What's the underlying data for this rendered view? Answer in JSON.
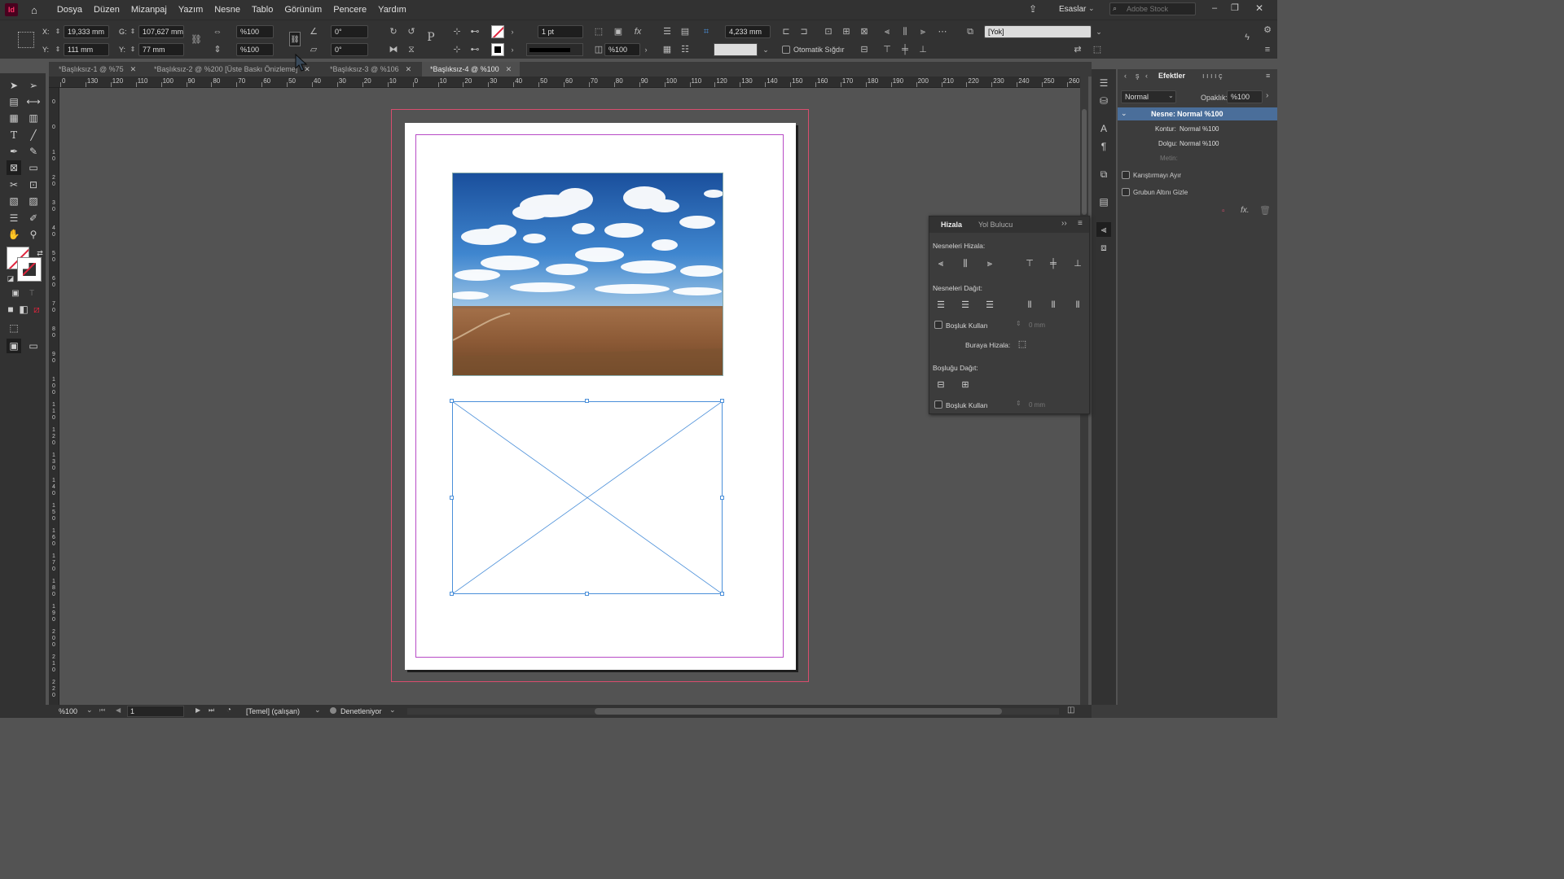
{
  "menubar": {
    "app_icon": "Id",
    "items": [
      "Dosya",
      "Düzen",
      "Mizanpaj",
      "Yazım",
      "Nesne",
      "Tablo",
      "Görünüm",
      "Pencere",
      "Yardım"
    ],
    "workspace": "Esaslar",
    "search_placeholder": "Adobe Stock"
  },
  "control": {
    "x_label": "X:",
    "x_value": "19,333 mm",
    "y_label": "Y:",
    "y_value": "111 mm",
    "w_label": "G:",
    "w_value": "107,627 mm",
    "h_label": "Y:",
    "h_value": "77 mm",
    "scale_x": "%100",
    "scale_y": "%100",
    "rotate": "0°",
    "shear": "0°",
    "stroke_weight": "1 pt",
    "opacity": "%100",
    "ref_value": "4,233 mm",
    "auto_fit_label": "Otomatik Sığdır",
    "object_style": "[Yok]"
  },
  "tabs": [
    {
      "label": "*Başlıksız-1 @ %75"
    },
    {
      "label": "*Başlıksız-2 @ %200 [Üste Baskı Önizleme]"
    },
    {
      "label": "*Başlıksız-3 @ %106"
    },
    {
      "label": "*Başlıksız-4 @ %100"
    }
  ],
  "ruler": {
    "h_ticks": [
      "0",
      "130",
      "120",
      "110",
      "100",
      "90",
      "80",
      "70",
      "60",
      "50",
      "40",
      "30",
      "20",
      "10",
      "0",
      "10",
      "20",
      "30",
      "40",
      "50",
      "60",
      "70",
      "80",
      "90",
      "100",
      "110",
      "120",
      "130",
      "140",
      "150",
      "160",
      "170",
      "180",
      "190",
      "200",
      "210",
      "220",
      "230",
      "240",
      "250",
      "260"
    ],
    "v_ticks": [
      "0",
      "0",
      "1 0",
      "2 0",
      "3 0",
      "4 0",
      "5 0",
      "6 0",
      "7 0",
      "8 0",
      "9 0",
      "1 0 0",
      "1 1 0",
      "1 2 0",
      "1 3 0",
      "1 4 0",
      "1 5 0",
      "1 6 0",
      "1 7 0",
      "1 8 0",
      "1 9 0",
      "2 0 0",
      "2 1 0",
      "2 2 0"
    ]
  },
  "effects_panel": {
    "tabs": [
      "Efektler"
    ],
    "blend_mode": "Normal",
    "opacity_label": "Opaklık:",
    "opacity_value": "%100",
    "rows": [
      {
        "label": "Nesne:",
        "value": "Normal %100"
      },
      {
        "label": "Kontur:",
        "value": "Normal %100"
      },
      {
        "label": "Dolgu:",
        "value": "Normal %100"
      },
      {
        "label": "Metin:",
        "value": ""
      }
    ],
    "checkbox_isolate": "Karıştırmayı Ayır",
    "checkbox_knockout": "Grubun Altını Gizle"
  },
  "align_panel": {
    "tab_align": "Hizala",
    "tab_pathfinder": "Yol Bulucu",
    "section_align": "Nesneleri Hizala:",
    "section_distribute": "Nesneleri Dağıt:",
    "use_spacing_1": "Boşluk Kullan",
    "spacing_1": "0 mm",
    "align_to_label": "Buraya Hizala:",
    "section_distribute_spacing": "Boşluğu Dağıt:",
    "use_spacing_2": "Boşluk Kullan",
    "spacing_2": "0 mm"
  },
  "status": {
    "zoom": "%100",
    "page": "1",
    "master": "[Temel] (çalışan)",
    "preflight": "Denetleniyor"
  }
}
